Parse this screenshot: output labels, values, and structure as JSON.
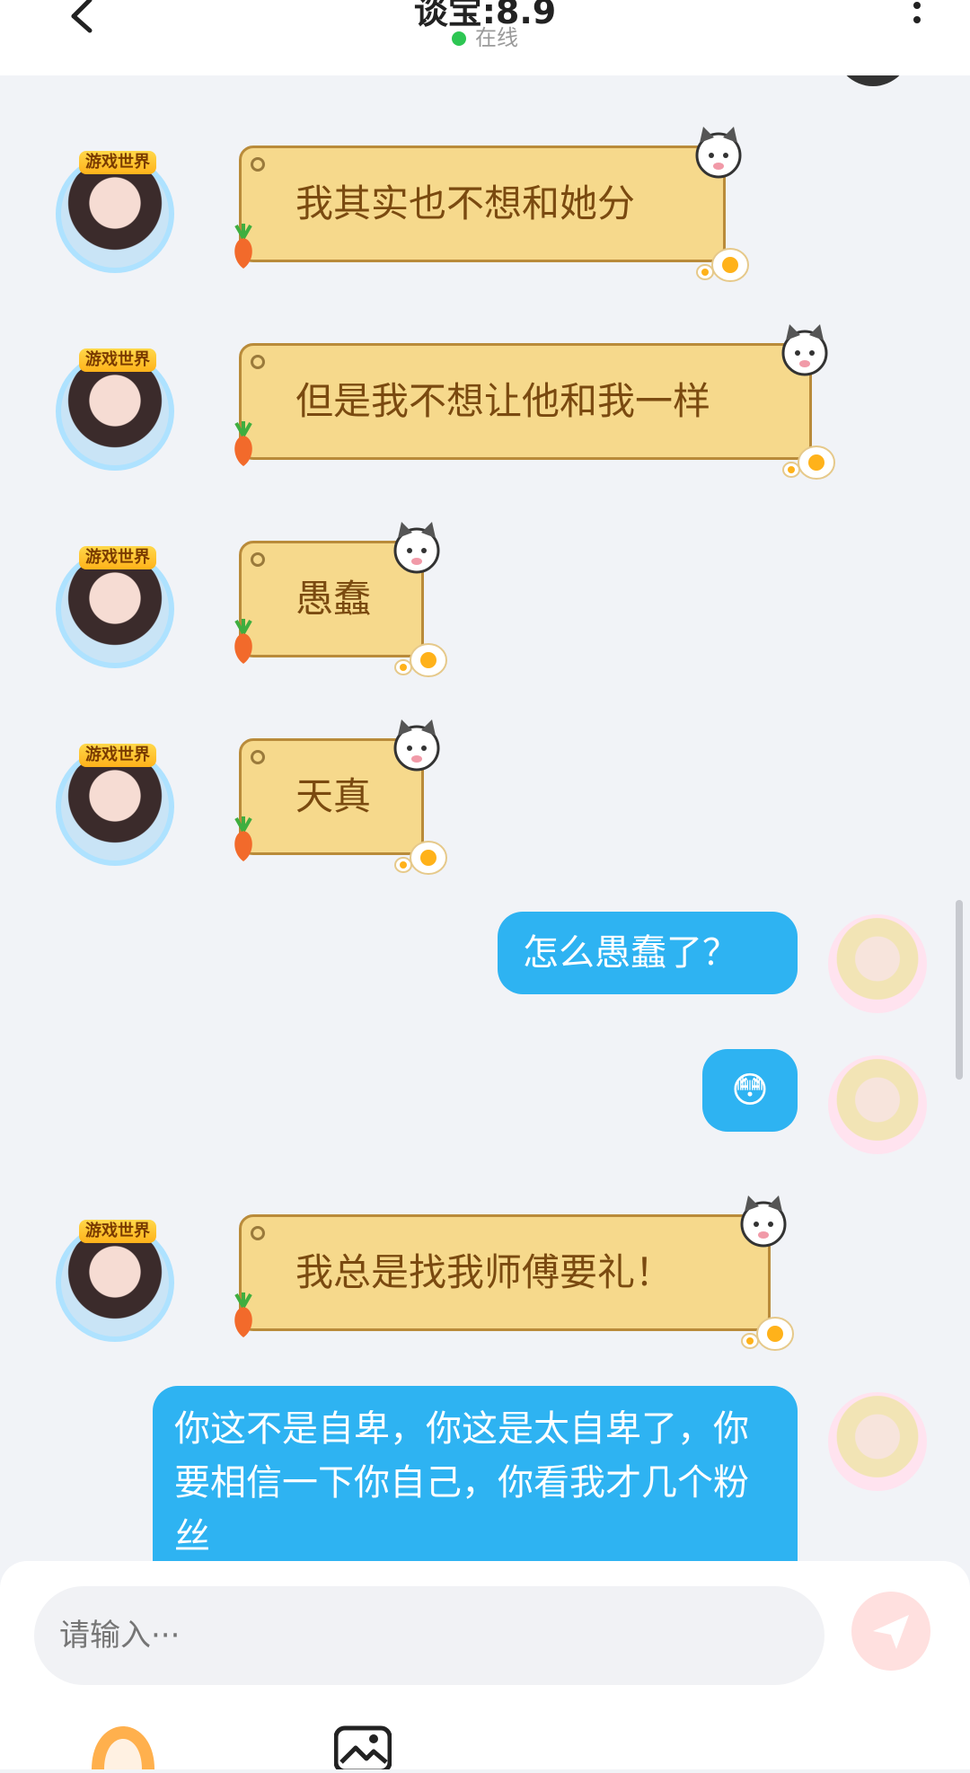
{
  "header": {
    "title": "谈宝:8.9",
    "status": "在线",
    "back_icon": "chevron-left-icon",
    "more_icon": "more-vertical-icon"
  },
  "messages": [
    {
      "side": "left",
      "text": "我其实也不想和她分"
    },
    {
      "side": "left",
      "text": "但是我不想让他和我一样"
    },
    {
      "side": "left",
      "text": "愚蠢"
    },
    {
      "side": "left",
      "text": "天真"
    },
    {
      "side": "right",
      "text": "怎么愚蠢了？"
    },
    {
      "side": "right",
      "text": "😳"
    },
    {
      "side": "left",
      "text": "我总是找我师傅要礼！"
    },
    {
      "side": "right",
      "text": "你这不是自卑，你这是太自卑了，你要相信一下你自己，你看我才几个粉丝"
    }
  ],
  "avatar_badge": "游戏世界",
  "input": {
    "placeholder": "请输入···"
  },
  "colors": {
    "accent": "#2eb3f2",
    "online": "#2dc653",
    "note_bg": "#f6d98c",
    "note_text": "#7a4a10",
    "send_bg": "#ffe0df"
  }
}
